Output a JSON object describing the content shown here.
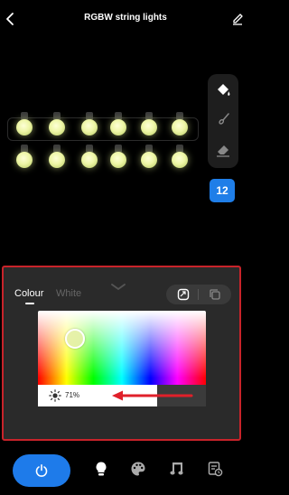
{
  "header": {
    "title": "RGBW string lights"
  },
  "tools": {
    "segment_count": "12"
  },
  "colour_panel": {
    "tabs": [
      {
        "label": "Colour",
        "active": true
      },
      {
        "label": "White",
        "active": false
      }
    ],
    "brightness_label": "71%",
    "brightness_level": 0.71
  },
  "colors": {
    "accent": "#1e7bea",
    "highlight_border": "#c8232a",
    "bulb_glow": "#eef6a6",
    "annotation_arrow": "#e0202a"
  },
  "icons": {
    "back": "chevron-left-icon",
    "edit": "pencil-icon",
    "paint_bucket": "paint-bucket-icon",
    "brush": "brush-icon",
    "eraser": "eraser-icon",
    "sheet_handle": "chevron-down-icon",
    "mode_a": "swap-square-icon",
    "mode_b": "copy-icon",
    "brightness": "sun-icon",
    "power": "power-icon",
    "nav_light": "bulb-icon",
    "nav_scene": "palette-icon",
    "nav_music": "music-icon",
    "nav_schedule": "schedule-icon"
  }
}
